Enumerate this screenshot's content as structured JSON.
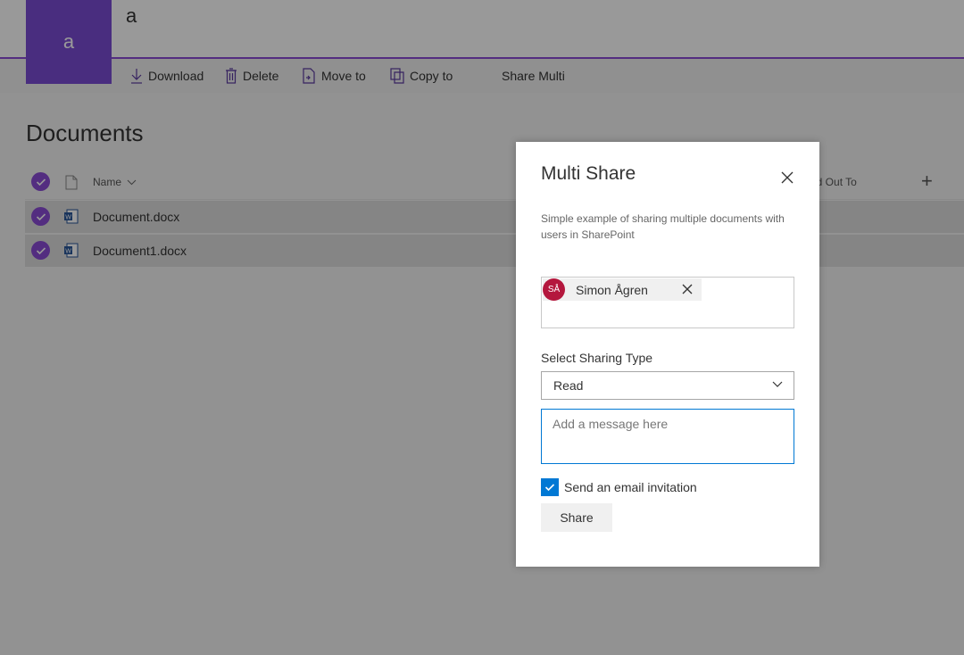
{
  "site": {
    "title": "a",
    "logo_letter": "a"
  },
  "commandbar": {
    "download": "Download",
    "delete": "Delete",
    "move_to": "Move to",
    "copy_to": "Copy to",
    "share_multi": "Share Multi"
  },
  "library": {
    "heading": "Documents",
    "columns": {
      "name": "Name",
      "checked_out_to": "ed Out To"
    },
    "rows": [
      {
        "name": "Document.docx",
        "icon": "word-icon",
        "selected": true
      },
      {
        "name": "Document1.docx",
        "icon": "word-icon",
        "selected": true
      }
    ]
  },
  "dialog": {
    "title": "Multi Share",
    "description": "Simple example of sharing multiple documents with users in SharePoint",
    "people": [
      {
        "initials": "SÅ",
        "name": "Simon Ågren"
      }
    ],
    "sharing_type_label": "Select Sharing Type",
    "sharing_type_value": "Read",
    "message_placeholder": "Add a message here",
    "email_invitation_label": "Send an email invitation",
    "email_invitation_checked": true,
    "share_button": "Share"
  },
  "colors": {
    "accent": "#8a4bd6",
    "primary_blue": "#0078d4",
    "avatar": "#b4173d"
  }
}
